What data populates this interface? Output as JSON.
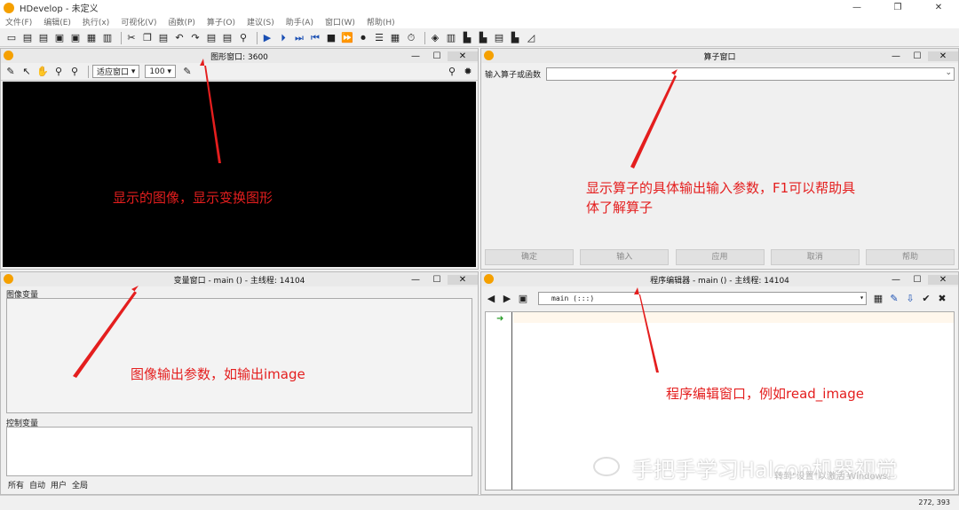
{
  "window": {
    "title": "HDevelop - 未定义",
    "ctrls": [
      "—",
      "❐",
      "✕"
    ]
  },
  "menu": [
    "文件(F)",
    "编辑(E)",
    "执行(x)",
    "可视化(V)",
    "函数(P)",
    "算子(O)",
    "建议(S)",
    "助手(A)",
    "窗口(W)",
    "帮助(H)"
  ],
  "graphics": {
    "title": "图形窗口: 3600",
    "fit_label": "适应窗口",
    "zoom_label": "100"
  },
  "operator": {
    "title": "算子窗口",
    "input_label": "输入算子或函数",
    "input_value": "",
    "buttons": [
      "确定",
      "输入",
      "应用",
      "取消",
      "帮助"
    ]
  },
  "variables": {
    "title": "变量窗口 - main () - 主线程: 14104",
    "iconic_label": "图像变量",
    "control_label": "控制变量",
    "tabs": [
      "所有",
      "自动",
      "用户",
      "全局"
    ]
  },
  "editor": {
    "title": "程序编辑器 - main () - 主线程: 14104",
    "procedure": "main (:::)"
  },
  "annotations": {
    "graphics": "显示的图像，显示变换图形",
    "operator_line1": "显示算子的具体输出输入参数，F1可以帮助具",
    "operator_line2": "体了解算子",
    "variables": "图像输出参数，如输出image",
    "editor": "程序编辑窗口，例如read_image"
  },
  "status": {
    "coords": "272, 393"
  },
  "watermark": {
    "text": "手把手学习Halcon机器视觉",
    "activate": "转到\"设置\"以激活 Windows。"
  }
}
